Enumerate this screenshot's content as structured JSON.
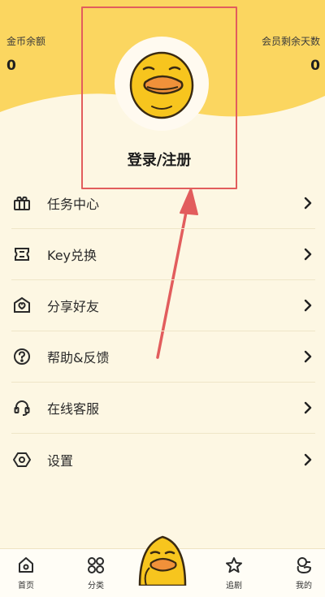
{
  "header": {
    "coins_label": "金币余额",
    "coins_value": "0",
    "vip_label": "会员剩余天数",
    "vip_value": "0"
  },
  "profile": {
    "login_label": "登录/注册"
  },
  "menu": {
    "items": [
      {
        "label": "任务中心",
        "icon": "gift-icon"
      },
      {
        "label": "Key兑换",
        "icon": "ticket-icon"
      },
      {
        "label": "分享好友",
        "icon": "heart-envelope-icon"
      },
      {
        "label": "帮助&反馈",
        "icon": "question-icon"
      },
      {
        "label": "在线客服",
        "icon": "headset-icon"
      },
      {
        "label": "设置",
        "icon": "settings-hex-icon"
      }
    ]
  },
  "tabbar": {
    "home": "首页",
    "category": "分类",
    "follow": "追剧",
    "mine": "我的"
  },
  "colors": {
    "header_yellow": "#fbd660",
    "background": "#fdf7e3",
    "highlight_red": "#e25d5d",
    "duck_yellow": "#f7c51e"
  }
}
